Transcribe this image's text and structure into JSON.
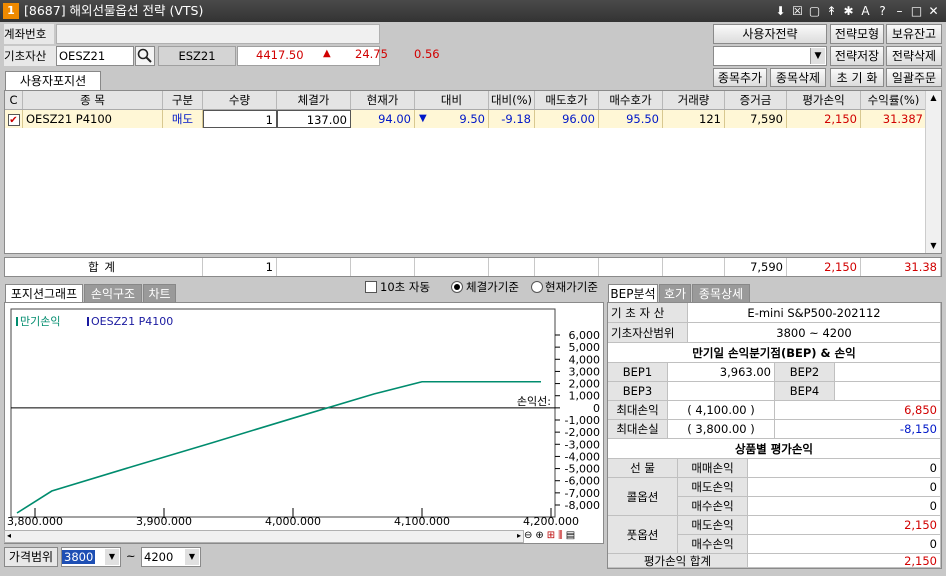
{
  "title": {
    "badge": "1",
    "text": "[8687] 해외선물옵션 전략 (VTS)"
  },
  "titlebar_icons": [
    "wallet-icon",
    "checkbox-icon",
    "monitor-icon",
    "pin-icon",
    "settings-icon",
    "font-icon",
    "help-icon",
    "minimize-icon",
    "maximize-icon",
    "close-icon"
  ],
  "titlebar_glyphs": [
    "⬇",
    "☒",
    "▢",
    "↟",
    "✱",
    "A",
    "?",
    "–",
    "□",
    "✕"
  ],
  "account": {
    "label": "계좌번호",
    "value": ""
  },
  "underlying": {
    "label": "기초자산",
    "code": "OESZ21",
    "name": "ESZ21",
    "price": "4417.50",
    "change": "24.75",
    "pct": "0.56",
    "arrow": "▲"
  },
  "buttons": {
    "user_strategy": "사용자전략",
    "strategy_model": "전략모형",
    "holdings": "보유잔고",
    "strategy_save": "전략저장",
    "strategy_delete": "전략삭제",
    "add_item": "종목추가",
    "delete_item": "종목삭제",
    "reset": "초 기 화",
    "bulk_order": "일괄주문"
  },
  "position_tab": "사용자포지션",
  "table": {
    "headers": [
      "C",
      "종 목",
      "구분",
      "수량",
      "체결가",
      "현재가",
      "대비",
      "대비(%)",
      "매도호가",
      "매수호가",
      "거래량",
      "증거금",
      "평가손익",
      "수익률(%)"
    ],
    "rows": [
      {
        "checked": "✔",
        "name": "OESZ21 P4100",
        "side": "매도",
        "qty": "1",
        "exec": "137.00",
        "cur": "94.00",
        "arrow": "▼",
        "chg": "9.50",
        "chgpct": "-9.18",
        "ask": "96.00",
        "bid": "95.50",
        "vol": "121",
        "margin": "7,590",
        "pnl": "2,150",
        "ret": "31.387"
      }
    ],
    "total": {
      "label": "합 계",
      "qty": "1",
      "margin": "7,590",
      "pnl": "2,150",
      "ret": "31.38"
    }
  },
  "chart_tabs": [
    "포지션그래프",
    "손익구조",
    "차트"
  ],
  "options": {
    "auto": "10초 자동",
    "exec_basis": "체결가기준",
    "cur_basis": "현재가기준"
  },
  "chart_data": {
    "type": "line",
    "legend": [
      "만기손익",
      "OESZ21 P4100"
    ],
    "x": [
      3750,
      3813,
      3875,
      3938,
      4000,
      4063,
      4100,
      4150,
      4200
    ],
    "y": [
      -8850,
      -6850,
      -4850,
      -2850,
      -850,
      1150,
      2150,
      2150,
      2150
    ],
    "xlim": [
      3800,
      4200
    ],
    "ylim": [
      -8000,
      6000
    ],
    "xticks": [
      "3,800.000",
      "3,900.000",
      "4,000.000",
      "4,100.000",
      "4,200.000"
    ],
    "yticks": [
      "6,000",
      "5,000",
      "4,000",
      "3,000",
      "2,000",
      "1,000",
      "0",
      "-1,000",
      "-2,000",
      "-3,000",
      "-4,000",
      "-5,000",
      "-6,000",
      "-7,000",
      "-8,000"
    ],
    "zero_label": "손익선:",
    "colors": {
      "payoff": "#008c6e",
      "option": "#1a1aa0"
    }
  },
  "range": {
    "label": "가격범위",
    "from": "3800",
    "to": "4200",
    "sep": "~"
  },
  "bep_tabs": [
    "BEP분석",
    "호가",
    "종목상세"
  ],
  "bep": {
    "underlying_label": "기 초 자 산",
    "underlying_value": "E-mini S&P500-202112",
    "range_label": "기초자산범위",
    "range_value": "3800 ~ 4200",
    "section1": "만기일 손익분기점(BEP) & 손익",
    "bep1_label": "BEP1",
    "bep1": "3,963.00",
    "bep2_label": "BEP2",
    "bep2": "",
    "bep3_label": "BEP3",
    "bep3": "",
    "bep4_label": "BEP4",
    "bep4": "",
    "max_profit_label": "최대손익",
    "max_profit_price": "4,100.00",
    "max_profit": "6,850",
    "max_loss_label": "최대손실",
    "max_loss_price": "3,800.00",
    "max_loss": "-8,150",
    "section2": "상품별 평가손익",
    "futures": "선 물",
    "call": "콜옵션",
    "put": "풋옵션",
    "trade_pnl": "매매손익",
    "short_pnl": "매도손익",
    "long_pnl": "매수손익",
    "fut_trade": "0",
    "call_short": "0",
    "call_long": "0",
    "put_short": "2,150",
    "put_long": "0",
    "total_label": "평가손익 합계",
    "total": "2,150"
  }
}
